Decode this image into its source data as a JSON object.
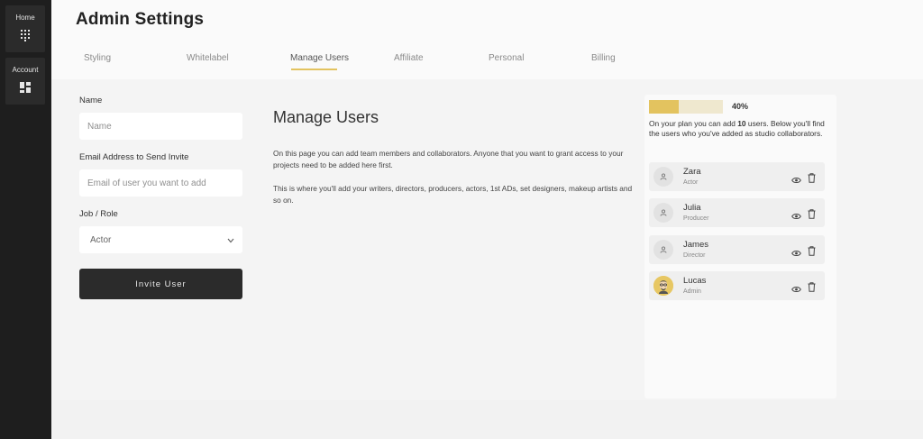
{
  "sidebar": {
    "items": [
      {
        "label": "Home",
        "icon": "keypad-icon"
      },
      {
        "label": "Account",
        "icon": "dashboard-grid-icon"
      }
    ]
  },
  "header": {
    "title": "Admin Settings"
  },
  "tabs": [
    {
      "label": "Styling"
    },
    {
      "label": "Whitelabel"
    },
    {
      "label": "Manage Users",
      "active": true
    },
    {
      "label": "Affiliate"
    },
    {
      "label": "Personal"
    },
    {
      "label": "Billing"
    }
  ],
  "form": {
    "name_label": "Name",
    "name_placeholder": "Name",
    "email_label": "Email Address to Send Invite",
    "email_placeholder": "Email of user you want to add",
    "role_label": "Job / Role",
    "role_selected": "Actor",
    "invite_button": "Invite User"
  },
  "content": {
    "title": "Manage Users",
    "paragraph1": "On this page you can add team members and collaborators. Anyone that you want to grant access to your projects need to be added here first.",
    "paragraph2": "This is where you'll add your writers, directors, producers, actors, 1st ADs, set designers, makeup artists and so on."
  },
  "plan": {
    "progress": 0.4,
    "progress_label": "40%",
    "text_before": "On your plan you can add ",
    "max_users": "10",
    "text_after": " users. Below you'll find the users who you've added as studio collaborators."
  },
  "users": [
    {
      "name": "Zara",
      "role": "Actor"
    },
    {
      "name": "Julia",
      "role": "Producer"
    },
    {
      "name": "James",
      "role": "Director"
    },
    {
      "name": "Lucas",
      "role": "Admin"
    }
  ],
  "colors": {
    "accent": "#e3c35f",
    "sidebar": "#1e1e1e",
    "button": "#2b2b2b"
  }
}
